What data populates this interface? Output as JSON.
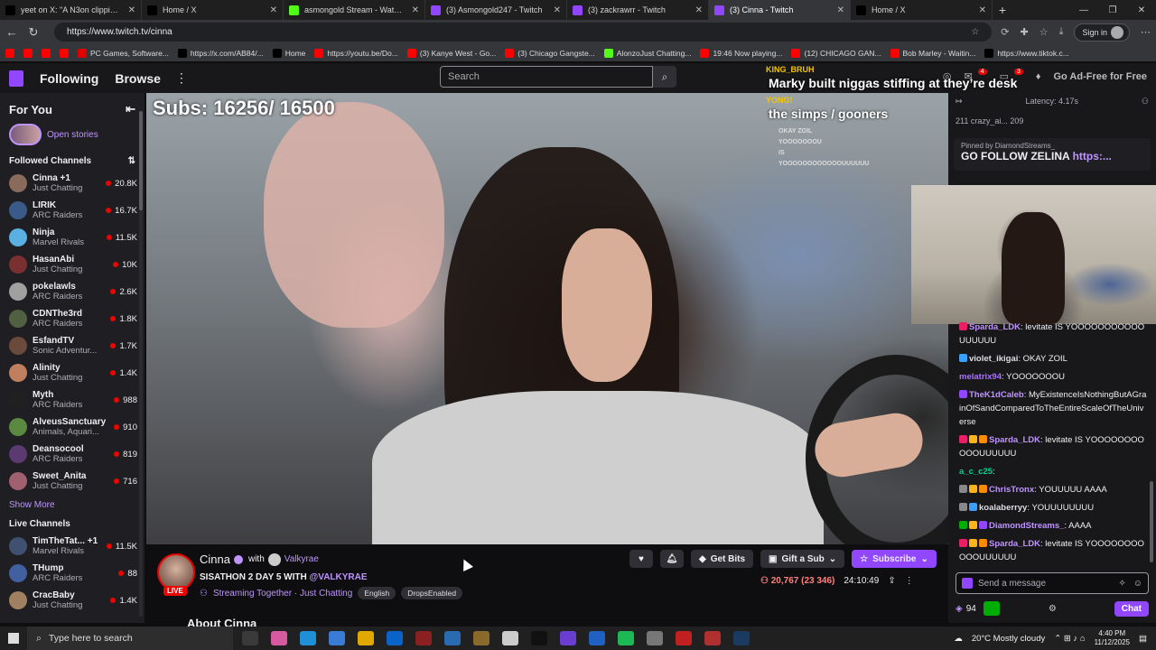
{
  "browser": {
    "tabs": [
      {
        "title": "yeet on X: \"A N3on clipping acco",
        "icon_color": "#000000",
        "icon": "x-icon",
        "active": false
      },
      {
        "title": "Home / X",
        "icon_color": "#000000",
        "icon": "x-icon",
        "active": false
      },
      {
        "title": "asmongold Stream - Watch Live",
        "icon_color": "#53fc18",
        "icon": "kick-icon",
        "active": false
      },
      {
        "title": "(3) Asmongold247 - Twitch",
        "icon_color": "#9146ff",
        "icon": "twitch-icon",
        "active": false
      },
      {
        "title": "(3) zackrawrr - Twitch",
        "icon_color": "#9146ff",
        "icon": "twitch-icon",
        "active": false
      },
      {
        "title": "(3) Cinna - Twitch",
        "icon_color": "#9146ff",
        "icon": "twitch-icon",
        "active": true
      },
      {
        "title": "Home / X",
        "icon_color": "#000000",
        "icon": "x-icon",
        "active": false
      }
    ],
    "url": "https://www.twitch.tv/cinna",
    "signin_label": "Sign in",
    "bookmarks": [
      {
        "label": "",
        "color": "#ff0000"
      },
      {
        "label": "",
        "color": "#ff0000"
      },
      {
        "label": "",
        "color": "#ff0000"
      },
      {
        "label": "",
        "color": "#ff0000"
      },
      {
        "label": "PC Games, Software...",
        "color": "#e00000"
      },
      {
        "label": "https://x.com/AB84/...",
        "color": "#000000"
      },
      {
        "label": "Home",
        "color": "#000000"
      },
      {
        "label": "https://youtu.be/Do...",
        "color": "#ff0000"
      },
      {
        "label": "(3) Kanye West - Go...",
        "color": "#ff0000"
      },
      {
        "label": "(3) Chicago Gangste...",
        "color": "#ff0000"
      },
      {
        "label": "AlonzoJust Chatting...",
        "color": "#53fc18"
      },
      {
        "label": "19:46 Now playing...",
        "color": "#ff0000"
      },
      {
        "label": "(12) CHICAGO GAN...",
        "color": "#ff0000"
      },
      {
        "label": "Bob Marley - Waitin...",
        "color": "#ff0000"
      },
      {
        "label": "https://www.tiktok.c...",
        "color": "#000000"
      }
    ]
  },
  "topnav": {
    "following": "Following",
    "browse": "Browse",
    "search_placeholder": "Search",
    "ad_free": "Go Ad-Free for Free",
    "notif_count_1": "4",
    "notif_count_2": "3"
  },
  "sidebar": {
    "for_you": "For You",
    "open_stories": "Open stories",
    "followed_title": "Followed Channels",
    "followed": [
      {
        "name": "Cinna +1",
        "game": "Just Chatting",
        "viewers": "20.8K",
        "color": "#8a6a5a"
      },
      {
        "name": "LIRIK",
        "game": "ARC Raiders",
        "viewers": "16.7K",
        "color": "#3a5a8a"
      },
      {
        "name": "Ninja",
        "game": "Marvel Rivals",
        "viewers": "11.5K",
        "color": "#5ab0e0"
      },
      {
        "name": "HasanAbi",
        "game": "Just Chatting",
        "viewers": "10K",
        "color": "#7a3030"
      },
      {
        "name": "pokelawls",
        "game": "ARC Raiders",
        "viewers": "2.6K",
        "color": "#a0a0a0"
      },
      {
        "name": "CDNThe3rd",
        "game": "ARC Raiders",
        "viewers": "1.8K",
        "color": "#506040"
      },
      {
        "name": "EsfandTV",
        "game": "Sonic Adventur...",
        "viewers": "1.7K",
        "color": "#6a4a3a"
      },
      {
        "name": "Alinity",
        "game": "Just Chatting",
        "viewers": "1.4K",
        "color": "#c08060"
      },
      {
        "name": "Myth",
        "game": "ARC Raiders",
        "viewers": "988",
        "color": "#202020"
      },
      {
        "name": "AlveusSanctuary",
        "game": "Animals, Aquari...",
        "viewers": "910",
        "color": "#5a8a40"
      },
      {
        "name": "Deansocool",
        "game": "ARC Raiders",
        "viewers": "819",
        "color": "#5a3a70"
      },
      {
        "name": "Sweet_Anita",
        "game": "Just Chatting",
        "viewers": "716",
        "color": "#a06070"
      }
    ],
    "show_more": "Show More",
    "live_title": "Live Channels",
    "live": [
      {
        "name": "TimTheTat...",
        "extra": "+1",
        "game": "Marvel Rivals",
        "viewers": "11.5K",
        "color": "#405070"
      },
      {
        "name": "THump",
        "extra": "",
        "game": "ARC Raiders",
        "viewers": "88",
        "color": "#4060a0"
      },
      {
        "name": "CracBaby",
        "extra": "",
        "game": "Just Chatting",
        "viewers": "1.4K",
        "color": "#a08060"
      }
    ]
  },
  "stream": {
    "subs_overlay": "Subs: 16256/ 16500",
    "overlay_chat": [
      {
        "user": "KING_BRUH",
        "msg": "Marky built niggas stiffing at they’re desk"
      },
      {
        "user": "YONG!",
        "msg": "the simps / gooners"
      }
    ],
    "overlay_small": [
      "OKAY ZOIL",
      "YOOOOOOOU",
      "IS",
      "YOOOOOOOOOOOOUUUUUU"
    ]
  },
  "channel": {
    "name": "Cinna",
    "with_label": "with",
    "collab": "Valkyrae",
    "live_badge": "LIVE",
    "title": "SISATHON 2 DAY 5 WITH",
    "title_tag": "@VALKYRAE",
    "category": "Streaming Together · Just Chatting",
    "tags": [
      "English",
      "DropsEnabled"
    ],
    "about": "About Cinna",
    "get_bits": "Get Bits",
    "gift_sub": "Gift a Sub",
    "subscribe": "Subscribe",
    "viewers": "20,767 (23 346)",
    "uptime": "24:10:49"
  },
  "chat": {
    "latency": "Latency: 4.17s",
    "top_row": "211   crazy_ai...   209",
    "pinned_by": "Pinned by DiamondStreams_",
    "pinned_msg": "GO FOLLOW ZELINA",
    "pinned_link": "https:...",
    "messages": [
      {
        "user": "Sparda_LDK",
        "color": "#bf94ff",
        "text": ": levitate IS YOOOOOOOOOOOUUUUUU",
        "badges": [
          "#e91e63"
        ]
      },
      {
        "user": "violet_ikigai",
        "color": "#dedee3",
        "text": ": OKAY ZOIL",
        "badges": [
          "#3aa0ff"
        ]
      },
      {
        "user": "melatrix94",
        "color": "#a970ff",
        "text": ": YOOOOOOOU",
        "badges": []
      },
      {
        "user": "TheK1dCaleb",
        "color": "#bf94ff",
        "text": ": MyExistenceIsNothingButAGrainOfSandComparedToTheEntireScaleOfTheUniverse",
        "badges": [
          "#9146ff"
        ]
      },
      {
        "user": "Sparda_LDK",
        "color": "#bf94ff",
        "text": ": levitate IS YOOOOOOOOOOOUUUUUU",
        "badges": [
          "#e91e63",
          "#ffb31a",
          "#ff8c00"
        ]
      },
      {
        "user": "a_c_c25",
        "color": "#00d68f",
        "text": ":",
        "badges": []
      },
      {
        "user": "ChrisTronx",
        "color": "#bf94ff",
        "text": ": YOUUUUU AAAA",
        "badges": [
          "#888888",
          "#ffb31a",
          "#ff8c00"
        ]
      },
      {
        "user": "koalaberryy",
        "color": "#dedee3",
        "text": ": YOUUUUUUUU",
        "badges": [
          "#888888",
          "#3aa0ff"
        ]
      },
      {
        "user": "DiamondStreams_",
        "color": "#bf94ff",
        "text": ": AAAA",
        "badges": [
          "#00ad03",
          "#ffb31a",
          "#9146ff"
        ]
      },
      {
        "user": "Sparda_LDK",
        "color": "#bf94ff",
        "text": ": levitate IS YOOOOOOOOOOOUUUUUU",
        "badges": [
          "#e91e63",
          "#ffb31a",
          "#ff8c00"
        ]
      }
    ],
    "input_placeholder": "Send a message",
    "points": "94",
    "chat_button": "Chat"
  },
  "taskbar": {
    "search_placeholder": "Type here to search",
    "weather": "20°C  Mostly cloudy",
    "time": "4:40 PM",
    "date": "11/12/2025"
  }
}
